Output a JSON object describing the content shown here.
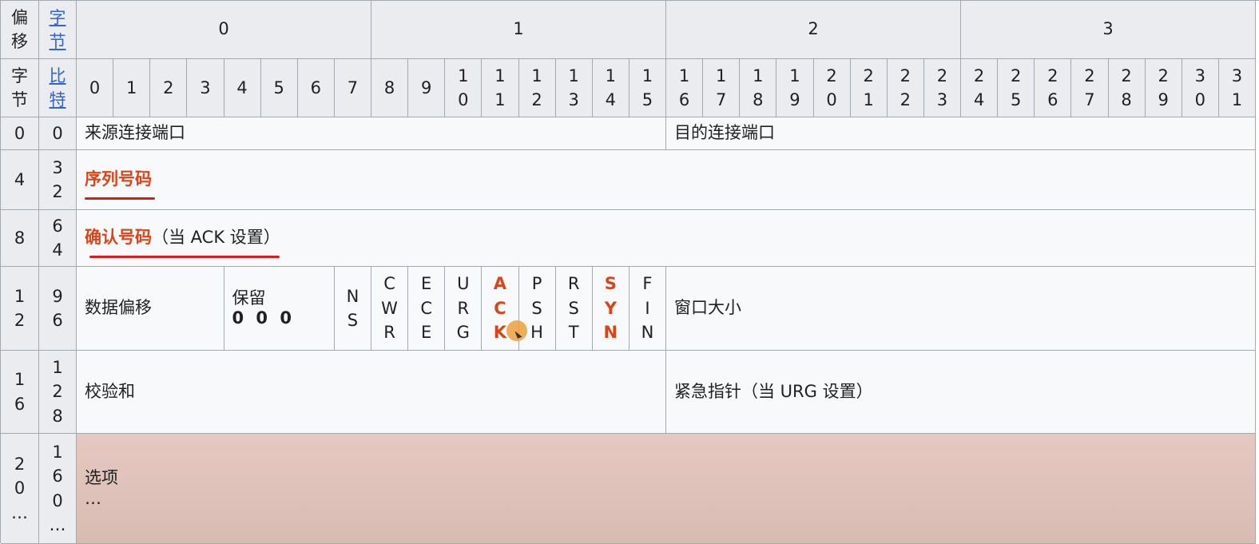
{
  "header": {
    "offset_label": [
      "偏",
      "移"
    ],
    "byte_link": [
      "字",
      "节"
    ],
    "byte_label": [
      "字",
      "节"
    ],
    "bit_link": [
      "比",
      "特"
    ],
    "octets": [
      "0",
      "1",
      "2",
      "3"
    ],
    "bits": [
      [
        "0"
      ],
      [
        "1"
      ],
      [
        "2"
      ],
      [
        "3"
      ],
      [
        "4"
      ],
      [
        "5"
      ],
      [
        "6"
      ],
      [
        "7"
      ],
      [
        "8"
      ],
      [
        "9"
      ],
      [
        "1",
        "0"
      ],
      [
        "1",
        "1"
      ],
      [
        "1",
        "2"
      ],
      [
        "1",
        "3"
      ],
      [
        "1",
        "4"
      ],
      [
        "1",
        "5"
      ],
      [
        "1",
        "6"
      ],
      [
        "1",
        "7"
      ],
      [
        "1",
        "8"
      ],
      [
        "1",
        "9"
      ],
      [
        "2",
        "0"
      ],
      [
        "2",
        "1"
      ],
      [
        "2",
        "2"
      ],
      [
        "2",
        "3"
      ],
      [
        "2",
        "4"
      ],
      [
        "2",
        "5"
      ],
      [
        "2",
        "6"
      ],
      [
        "2",
        "7"
      ],
      [
        "2",
        "8"
      ],
      [
        "2",
        "9"
      ],
      [
        "3",
        "0"
      ],
      [
        "3",
        "1"
      ]
    ]
  },
  "rows": [
    {
      "byte": [
        "0"
      ],
      "bit": [
        "0"
      ]
    },
    {
      "byte": [
        "4"
      ],
      "bit": [
        "3",
        "2"
      ]
    },
    {
      "byte": [
        "8"
      ],
      "bit": [
        "6",
        "4"
      ]
    },
    {
      "byte": [
        "1",
        "2"
      ],
      "bit": [
        "9",
        "6"
      ]
    },
    {
      "byte": [
        "1",
        "6"
      ],
      "bit": [
        "1",
        "2",
        "8"
      ]
    },
    {
      "byte": [
        "2",
        "0",
        "…"
      ],
      "bit": [
        "1",
        "6",
        "0",
        "…"
      ]
    }
  ],
  "fields": {
    "source_port": "来源连接端口",
    "dest_port": "目的连接端口",
    "seq_number": "序列号码",
    "ack_number": "确认号码",
    "ack_note": "（当 ACK 设置）",
    "data_offset": "数据偏移",
    "reserved": "保留",
    "reserved_bits": "0 0 0",
    "flags": [
      {
        "name": "NS",
        "chars": [
          "N",
          "S"
        ]
      },
      {
        "name": "CWR",
        "chars": [
          "C",
          "W",
          "R"
        ]
      },
      {
        "name": "ECE",
        "chars": [
          "E",
          "C",
          "E"
        ]
      },
      {
        "name": "URG",
        "chars": [
          "U",
          "R",
          "G"
        ]
      },
      {
        "name": "ACK",
        "chars": [
          "A",
          "C",
          "K"
        ]
      },
      {
        "name": "PSH",
        "chars": [
          "P",
          "S",
          "H"
        ]
      },
      {
        "name": "RST",
        "chars": [
          "R",
          "S",
          "T"
        ]
      },
      {
        "name": "SYN",
        "chars": [
          "S",
          "Y",
          "N"
        ]
      },
      {
        "name": "FIN",
        "chars": [
          "F",
          "I",
          "N"
        ]
      }
    ],
    "window_size": "窗口大小",
    "checksum": "校验和",
    "urgent_pointer": "紧急指针（当 URG 设置）",
    "options": "选项",
    "options_more": "…"
  },
  "highlight": {
    "flags": [
      "ACK",
      "SYN"
    ],
    "color": "#d9451b",
    "underline_color": "#d41f1f",
    "options_bg": "#e2c5be"
  }
}
